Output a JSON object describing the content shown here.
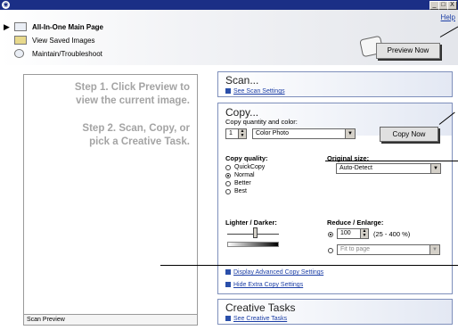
{
  "window": {
    "minimize": "_",
    "maximize": "□",
    "close": "X"
  },
  "nav": {
    "items": [
      {
        "label": "All-In-One Main Page"
      },
      {
        "label": "View Saved Images"
      },
      {
        "label": "Maintain/Troubleshoot"
      }
    ]
  },
  "help_label": "Help",
  "preview_button": "Preview Now",
  "preview_pane": {
    "step1_line1": "Step 1.  Click Preview to",
    "step1_line2": "view the current image.",
    "step2_line1": "Step 2.  Scan, Copy, or",
    "step2_line2": "pick a Creative Task.",
    "status": "Scan Preview"
  },
  "scan": {
    "title": "Scan...",
    "link": "See Scan Settings"
  },
  "copy": {
    "title": "Copy...",
    "subtitle": "Copy quantity and color:",
    "quantity": "1",
    "color": "Color Photo",
    "copy_button": "Copy Now",
    "quality_label": "Copy quality:",
    "quality_options": [
      "QuickCopy",
      "Normal",
      "Better",
      "Best"
    ],
    "quality_selected": "Normal",
    "original_size_label": "Original size:",
    "original_size": "Auto-Detect",
    "lighter_label": "Lighter / Darker:",
    "lighter_level": 0.55,
    "reduce_label": "Reduce / Enlarge:",
    "percent_value": "100",
    "percent_range": "(25 - 400 %)",
    "fit_label": "Fit to page",
    "advanced_link": "Display Advanced Copy Settings",
    "hide_link": "Hide Extra Copy Settings"
  },
  "creative": {
    "title": "Creative Tasks",
    "link": "See Creative Tasks"
  },
  "colors": {
    "titlebar": "#1b2f86",
    "link": "#1d3fa6",
    "panel_border": "#7e8fbb"
  }
}
